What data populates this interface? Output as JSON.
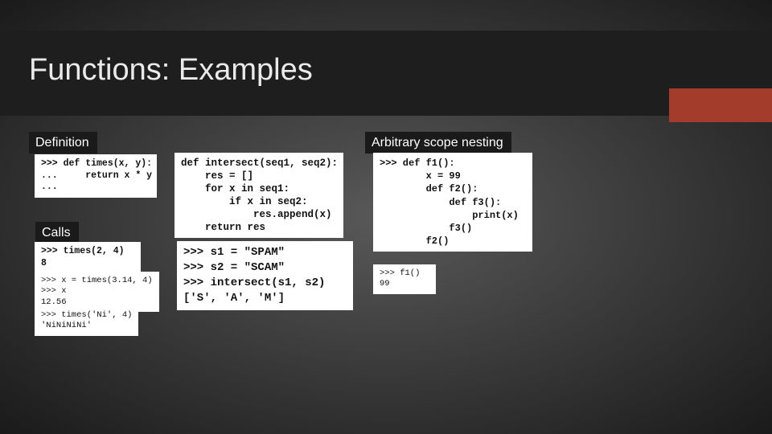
{
  "title": "Functions: Examples",
  "labels": {
    "definition": "Definition",
    "calls": "Calls",
    "scope": "Arbitrary scope nesting"
  },
  "code": {
    "times_def": ">>> def times(x, y):\n...     return x * y\n...",
    "call1": ">>> times(2, 4)\n8",
    "call2": ">>> x = times(3.14, 4)\n>>> x\n12.56",
    "call3": ">>> times('Ni', 4)\n'NiNiNiNi'",
    "intersect_def": "def intersect(seq1, seq2):\n    res = []\n    for x in seq1:\n        if x in seq2:\n            res.append(x)\n    return res",
    "intersect_call": ">>> s1 = \"SPAM\"\n>>> s2 = \"SCAM\"\n>>> intersect(s1, s2)\n['S', 'A', 'M']",
    "scope_def": ">>> def f1():\n        x = 99\n        def f2():\n            def f3():\n                print(x)\n            f3()\n        f2()",
    "scope_call": ">>> f1()\n99"
  }
}
